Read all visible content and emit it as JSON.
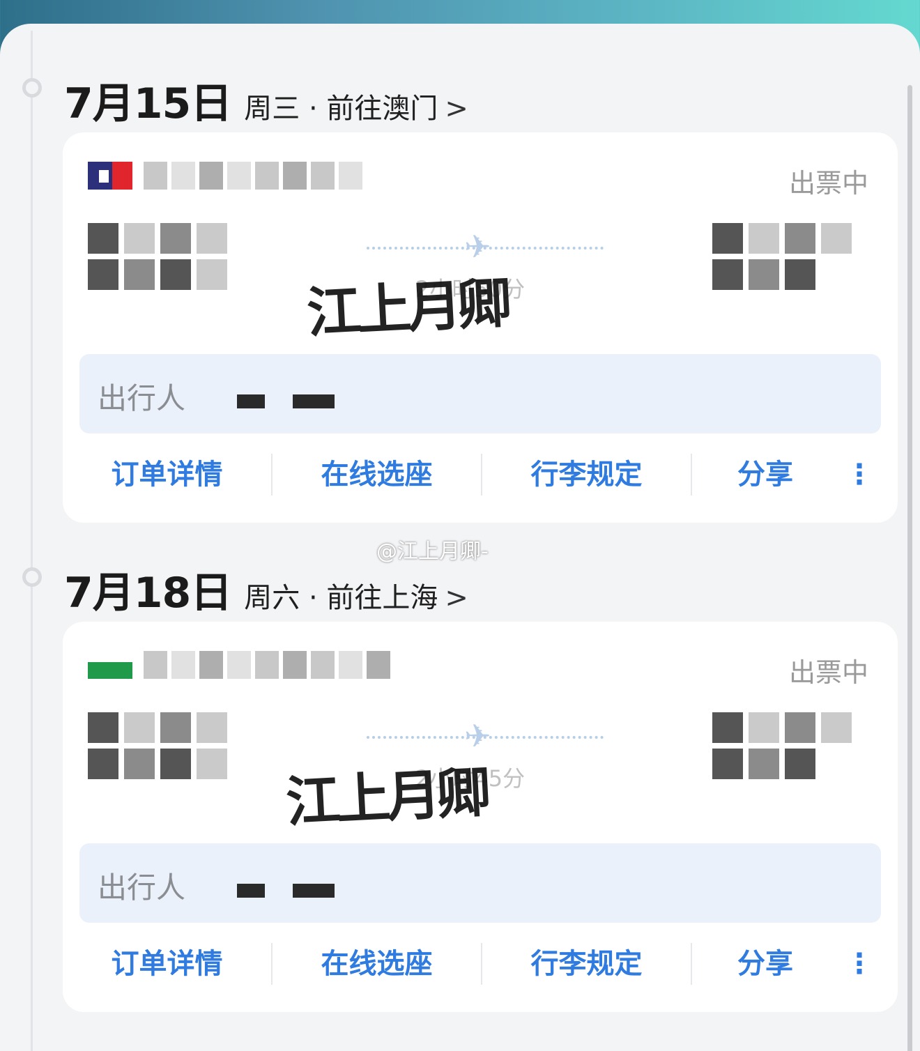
{
  "days": [
    {
      "date": "7月15日",
      "subtitle": "周三 · 前往澳门",
      "chevron": ">",
      "status": "出票中",
      "airline_color": "#e0252d",
      "duration": "2小时50分",
      "passenger_label": "出行人",
      "actions": [
        "订单详情",
        "在线选座",
        "行李规定",
        "分享"
      ],
      "more": "⋮"
    },
    {
      "date": "7月18日",
      "subtitle": "周六 · 前往上海",
      "chevron": ">",
      "status": "出票中",
      "airline_color": "#1f9a4b",
      "duration": "2小时45分",
      "passenger_label": "出行人",
      "actions": [
        "订单详情",
        "在线选座",
        "行李规定",
        "分享"
      ],
      "more": "⋮"
    }
  ],
  "watermark_text": "江上月卿",
  "weibo_tag": "@江上月卿-",
  "colors": {
    "accent": "#2f7be0",
    "status": "#9a9a9a",
    "passenger_bg": "#eaf1fb"
  }
}
